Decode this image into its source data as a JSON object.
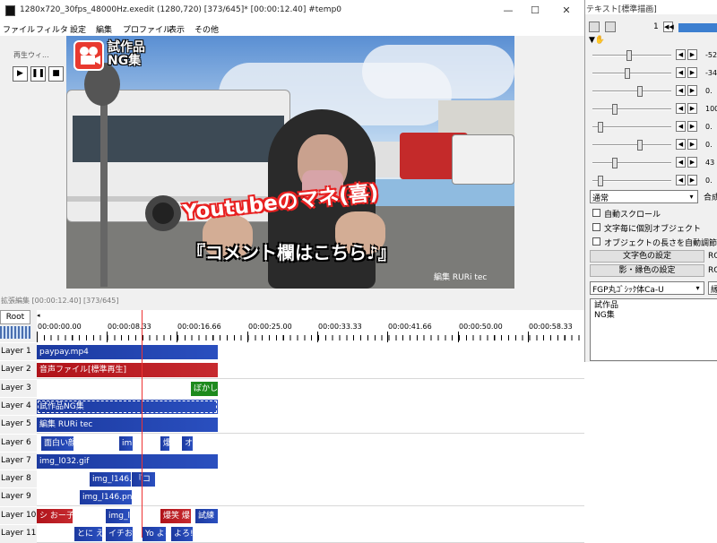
{
  "window": {
    "title": "1280x720_30fps_48000Hz.exedit (1280,720)  [373/645]* [00:00:12.40]  #temp0",
    "minimize": "—",
    "maximize": "☐",
    "close": "✕"
  },
  "menu": [
    "ファイル",
    "フィルタ",
    "設定",
    "編集",
    "プロファイル",
    "表示",
    "その他"
  ],
  "preview": {
    "logo_line1": "試作品",
    "logo_line2": "NG集",
    "subtitle_red": "Youtubeのマネ(喜)",
    "subtitle_black": "『コメント欄はこちら♪』",
    "credit": "編集 RURi tec"
  },
  "playback": {
    "title": "再生ウィ...",
    "play": "▶",
    "pause": "❚❚",
    "stop": "■"
  },
  "panel": {
    "title": "テキスト[標準描画]",
    "page_number": "1",
    "params": [
      "-52",
      "-34",
      "0.",
      "100",
      "0.",
      "0.",
      "43",
      "0."
    ],
    "blend_mode": "通常",
    "blend_side": "合成",
    "checks": [
      "自動スクロール",
      "文字毎に個別オブジェクト",
      "オブジェクトの長さを自動調節"
    ],
    "btn_text_color": "文字色の設定",
    "btn_shadow_color": "影・縁色の設定",
    "btn_side1": "RG",
    "btn_side2": "RG",
    "font": "FGP丸ｺﾞｼｯｸ体Ca-U",
    "font_side": "縁",
    "text_value": "試作品\nNG集"
  },
  "timeline": {
    "title": "拡張編集 [00:00:12.40] [373/645]",
    "root": "Root",
    "ticks": [
      "00:00:00.00",
      "00:00:08.33",
      "00:00:16.66",
      "00:00:25.00",
      "00:00:33.33",
      "00:00:41.66",
      "00:00:50.00",
      "00:00:58.33"
    ],
    "layers": [
      {
        "label": "Layer 1",
        "clips": [
          {
            "text": "paypay.mp4",
            "color": "blue"
          }
        ]
      },
      {
        "label": "Layer 2",
        "clips": [
          {
            "text": "音声ファイル[標準再生]",
            "color": "red"
          }
        ]
      },
      {
        "label": "Layer 3",
        "clips": [
          {
            "text": "ぼかし",
            "color": "green"
          }
        ]
      },
      {
        "label": "Layer 4",
        "clips": [
          {
            "text": "試作品NG集",
            "color": "blue"
          }
        ]
      },
      {
        "label": "Layer 5",
        "clips": [
          {
            "text": "編集 RURi tec",
            "color": "blue"
          }
        ]
      },
      {
        "label": "Layer 6",
        "clips": [
          {
            "text": "面白い顔",
            "color": "blue"
          },
          {
            "text": "im",
            "color": "blue"
          },
          {
            "text": "爆",
            "color": "blue"
          },
          {
            "text": "オ",
            "color": "blue"
          }
        ]
      },
      {
        "label": "Layer 7",
        "clips": [
          {
            "text": "img_l032.gif",
            "color": "blue"
          }
        ]
      },
      {
        "label": "Layer 8",
        "clips": [
          {
            "text": "img_l146.p",
            "color": "blue"
          },
          {
            "text": "『コ",
            "color": "blue"
          }
        ]
      },
      {
        "label": "Layer 9",
        "clips": [
          {
            "text": "img_l146.png",
            "color": "blue"
          }
        ]
      },
      {
        "label": "Layer 10",
        "clips": [
          {
            "text": "シ おー子",
            "color": "red"
          },
          {
            "text": "img_l",
            "color": "blue"
          },
          {
            "text": "爆笑 爆",
            "color": "red"
          },
          {
            "text": "試練",
            "color": "blue"
          }
        ]
      },
      {
        "label": "Layer 11",
        "clips": [
          {
            "text": "とに えぇ",
            "color": "blue"
          },
          {
            "text": "イチお",
            "color": "blue"
          },
          {
            "text": "Yo よろ",
            "color": "blue"
          },
          {
            "text": "よろ!",
            "color": "blue"
          }
        ]
      }
    ]
  }
}
